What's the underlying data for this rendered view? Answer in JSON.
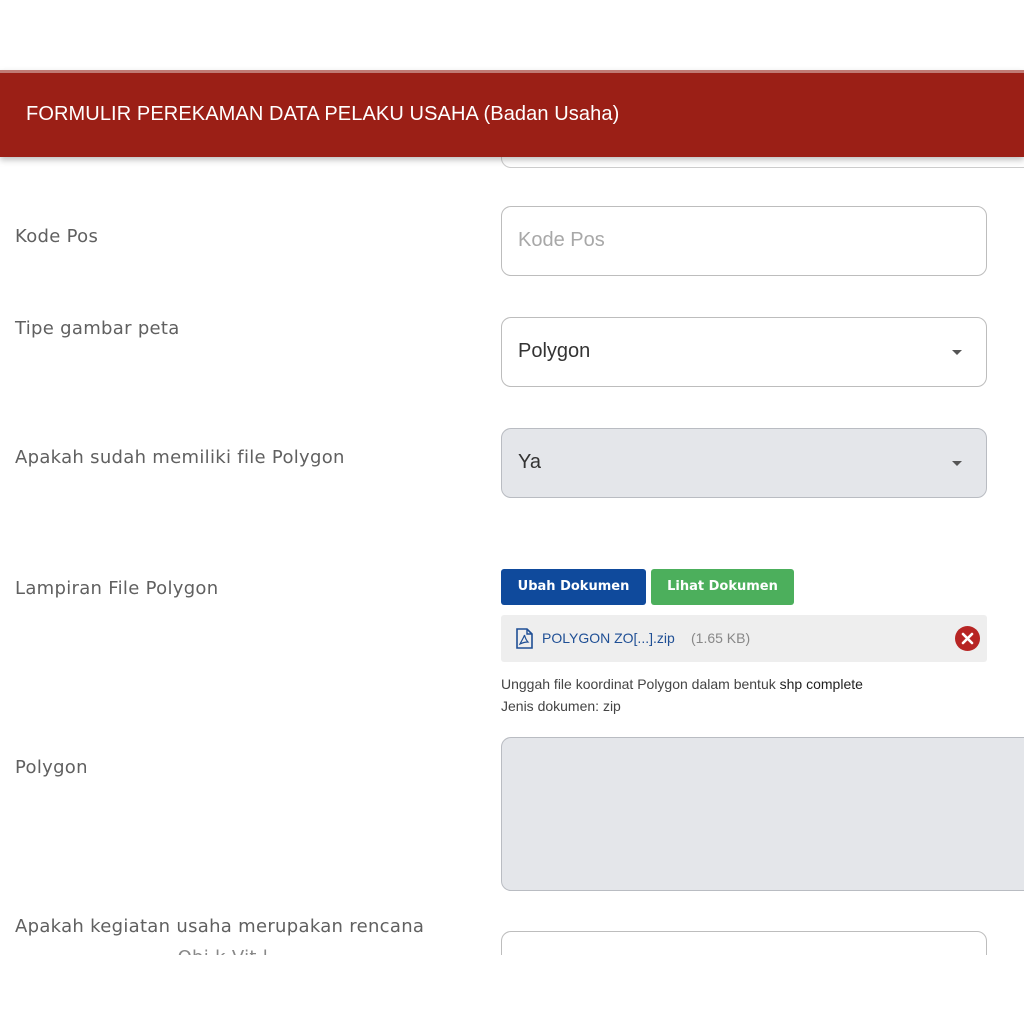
{
  "header": {
    "title": "FORMULIR PEREKAMAN DATA PELAKU USAHA (Badan Usaha)"
  },
  "form": {
    "kode_pos": {
      "label": "Kode Pos",
      "placeholder": "Kode Pos",
      "value": ""
    },
    "tipe_gambar_peta": {
      "label": "Tipe gambar peta",
      "value": "Polygon"
    },
    "memiliki_file_polygon": {
      "label": "Apakah sudah memiliki file Polygon",
      "value": "Ya"
    },
    "lampiran": {
      "label": "Lampiran File Polygon",
      "change_button": "Ubah Dokumen",
      "view_button": "Lihat Dokumen",
      "file_name": "POLYGON ZO[...].zip",
      "file_size": "(1.65 KB)",
      "hint_prefix": "Unggah file koordinat Polygon dalam bentuk ",
      "hint_emphasis": "shp complete",
      "hint_type": "Jenis dokumen: zip"
    },
    "polygon": {
      "label": "Polygon",
      "value": ""
    },
    "rencana": {
      "label_line1": "Apakah kegiatan usaha merupakan rencana",
      "label_line2": "...........................Obj.k.Vit.l"
    }
  },
  "colors": {
    "header": "#9b1f16",
    "primary_button": "#0f4a9c",
    "success_button": "#4caf5c",
    "remove": "#b72524"
  },
  "icons": {
    "file": "pdf-file-icon",
    "remove": "close-circle-icon",
    "dropdown": "chevron-down-icon"
  }
}
